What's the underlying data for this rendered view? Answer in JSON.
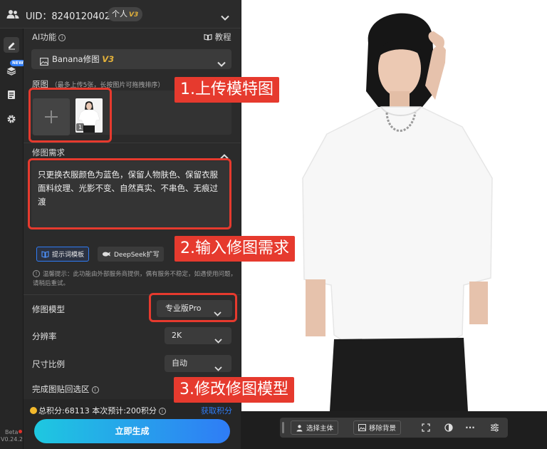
{
  "account": {
    "uid_text": "UID：8240120402",
    "plan_label": "个人",
    "plan_version": "V3"
  },
  "rail": {
    "new_badge": "NEW",
    "beta_label": "Beta",
    "version": "V0.24.2"
  },
  "ai_function": {
    "label": "AI功能",
    "tutorial_label": "教程",
    "selected_tool": "Banana修图",
    "selected_tool_version": "V3"
  },
  "source_image": {
    "label": "原图",
    "hint": "（最多上传5张，长按图片可拖拽排序）",
    "thumb_index": "1"
  },
  "edit_request": {
    "label": "修图需求",
    "text": "只更换衣服颜色为蓝色，保留人物肤色、保留衣服面料纹理、光影不变、自然真实、不串色、无痕过渡",
    "template_button": "提示词模板",
    "deepseek_button": "DeepSeek扩写",
    "notice": "温馨提示：此功能由外部服务商提供，偶有服务不稳定，如遇使用问题，请稍后重试。"
  },
  "settings": {
    "model_label": "修图模型",
    "model_value": "专业版Pro",
    "resolution_label": "分辨率",
    "resolution_value": "2K",
    "ratio_label": "尺寸比例",
    "ratio_value": "自动",
    "paste_back_label": "完成图贴回选区"
  },
  "footer": {
    "points_text": "总积分:68113  本次预计:200积分",
    "earn_label": "获取积分",
    "generate_button": "立即生成"
  },
  "canvas_toolbar": {
    "select_subject": "选择主体",
    "remove_bg": "移除背景",
    "more": "···"
  },
  "annotations": {
    "step1": "1.上传模特图",
    "step2": "2.输入修图需求",
    "step3": "3.修改修图模型"
  },
  "colors": {
    "accent_blue": "#2f7cf6",
    "annotation_red": "#e63a2e",
    "plan_gold": "#e4b23a",
    "points_coin": "#f3b92c"
  }
}
